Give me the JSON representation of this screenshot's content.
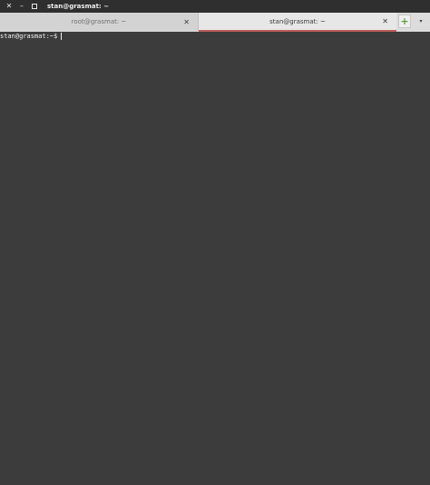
{
  "window": {
    "title": "stan@grasmat: ~",
    "controls": {
      "close_glyph": "✕",
      "minimize_glyph": "–"
    }
  },
  "tabs": [
    {
      "label": "root@grasmat: ~",
      "active": false,
      "close_glyph": "✕"
    },
    {
      "label": "stan@grasmat: ~",
      "active": true,
      "close_glyph": "✕"
    }
  ],
  "tabbar": {
    "new_tab_glyph": "+",
    "menu_glyph": "▾"
  },
  "terminal": {
    "prompt": "stan@grasmat:~$",
    "input": ""
  },
  "colors": {
    "terminal_bg": "#3c3c3c",
    "titlebar_bg": "#2f2f2f",
    "active_tab_underline": "#c0605a",
    "new_tab_plus": "#5fa43a"
  }
}
